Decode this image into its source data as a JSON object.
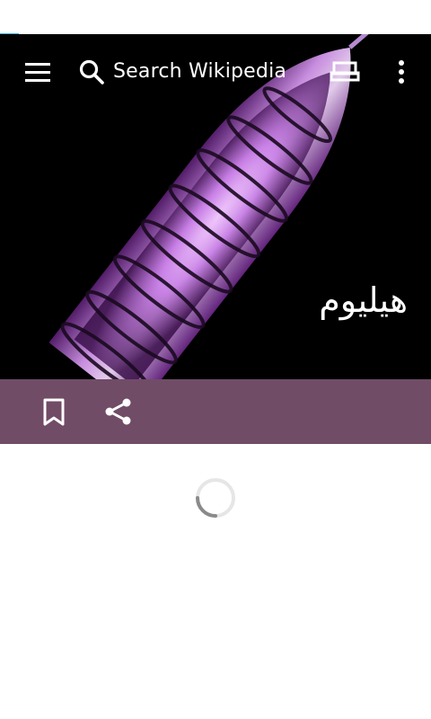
{
  "toolbar": {
    "search_placeholder": "Search Wikipedia",
    "menu_icon": "hamburger-menu-icon",
    "search_icon": "magnifier-icon",
    "reading_lists_icon": "reading-lists-icon",
    "overflow_icon": "vertical-dots-icon"
  },
  "article": {
    "title": "هيليوم",
    "lead_image": "glowing helium discharge tube"
  },
  "actions": {
    "bookmark_icon": "bookmark-icon",
    "share_icon": "share-icon"
  },
  "loading": {
    "indicator": "spinner"
  },
  "colors": {
    "action_bar": "#714c66",
    "progress_accent": "#33b5e5",
    "hero_background": "#000000"
  }
}
